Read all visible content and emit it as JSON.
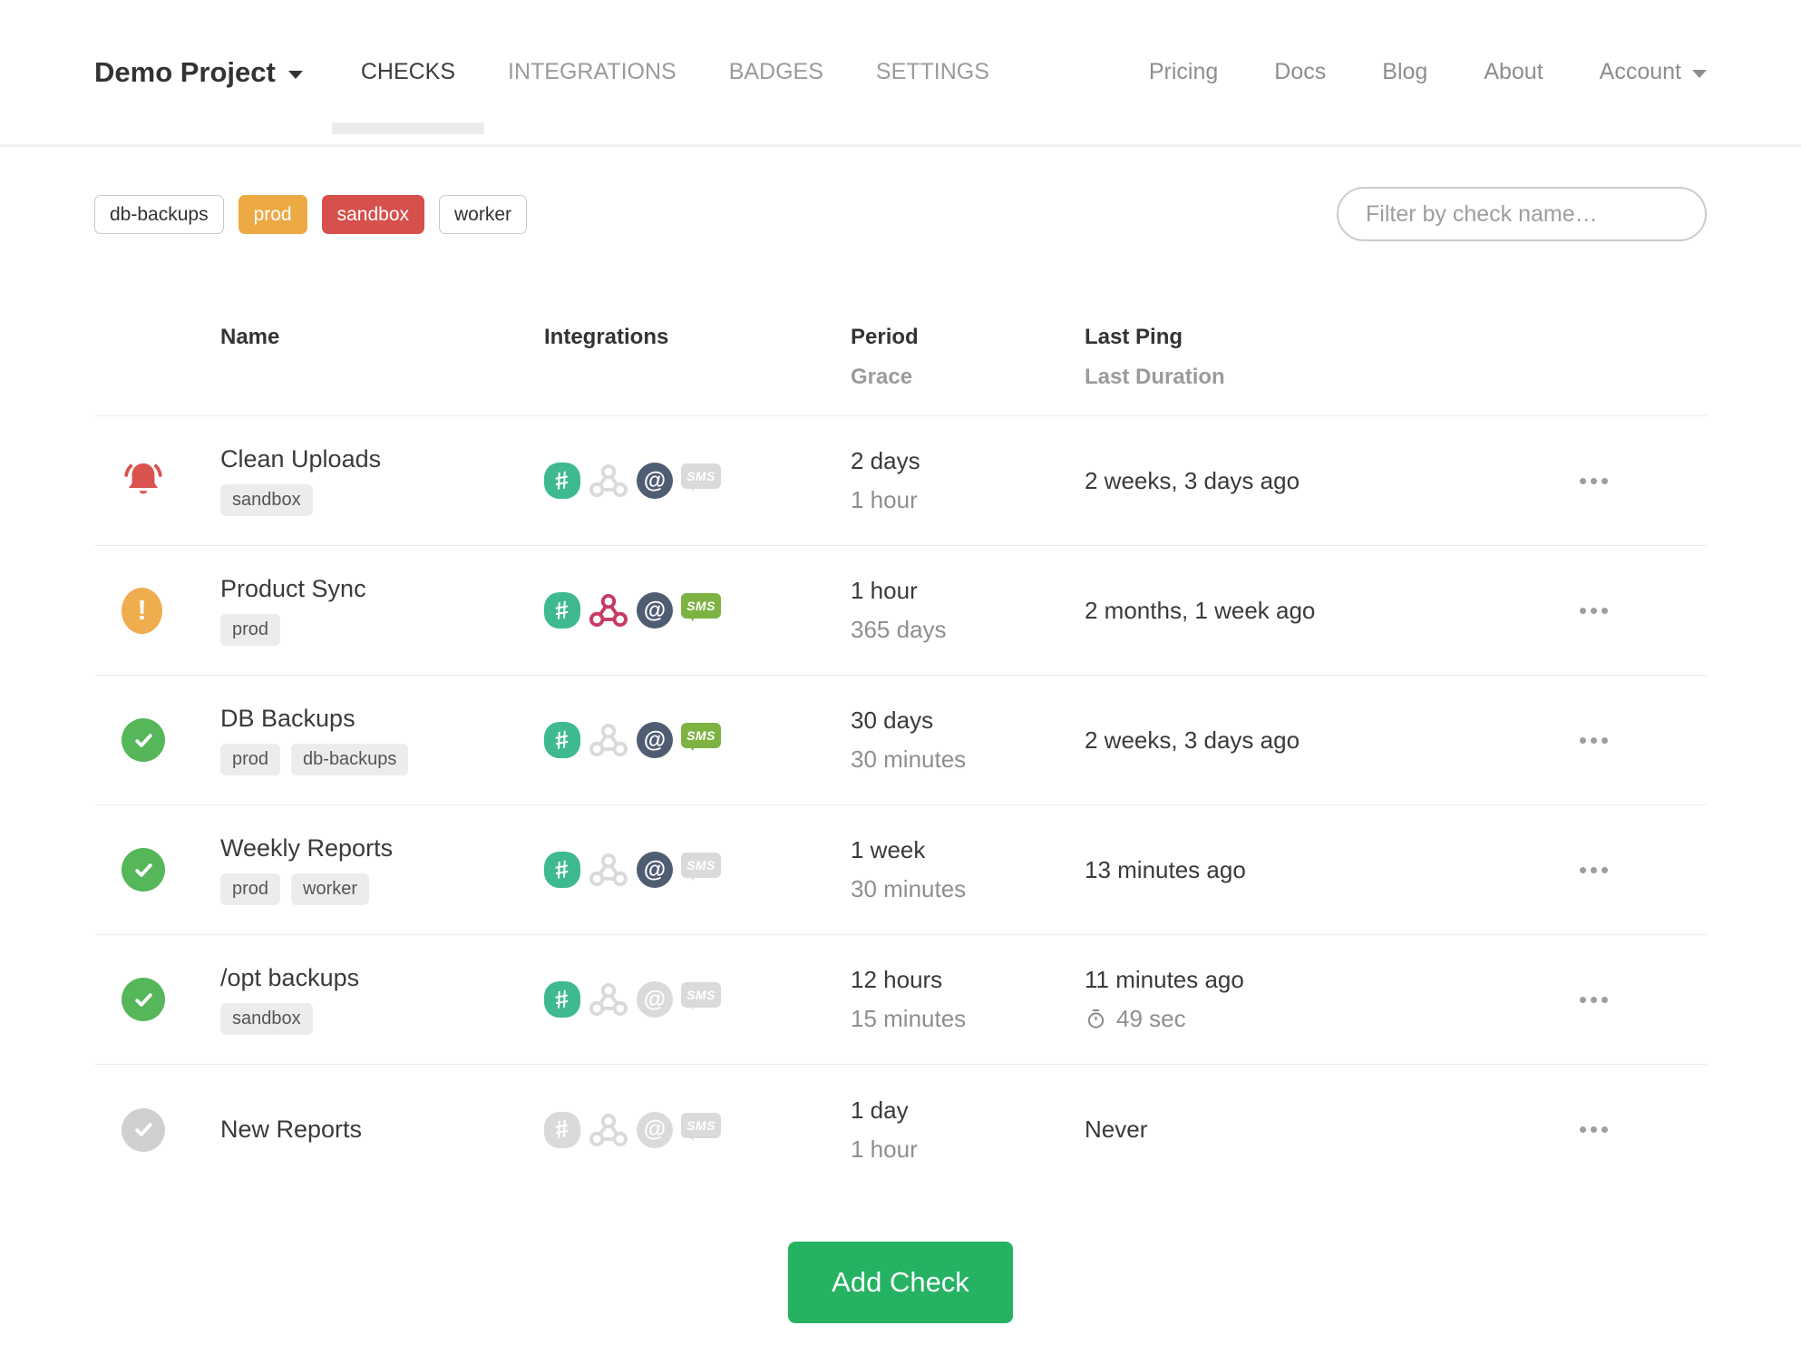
{
  "brand": {
    "project_name": "Demo Project"
  },
  "nav": {
    "tabs": [
      {
        "label": "CHECKS",
        "active": true
      },
      {
        "label": "INTEGRATIONS",
        "active": false
      },
      {
        "label": "BADGES",
        "active": false
      },
      {
        "label": "SETTINGS",
        "active": false
      }
    ],
    "links": [
      "Pricing",
      "Docs",
      "Blog",
      "About"
    ],
    "account_label": "Account"
  },
  "filters": {
    "tags": [
      {
        "label": "db-backups",
        "variant": "outline"
      },
      {
        "label": "prod",
        "variant": "orange"
      },
      {
        "label": "sandbox",
        "variant": "red"
      },
      {
        "label": "worker",
        "variant": "outline"
      }
    ],
    "search_placeholder": "Filter by check name…"
  },
  "table": {
    "headers": {
      "name": "Name",
      "integrations": "Integrations",
      "period": "Period",
      "grace": "Grace",
      "last_ping": "Last Ping",
      "last_duration": "Last Duration"
    },
    "rows": [
      {
        "name": "Clean Uploads",
        "status": "alert",
        "tags": [
          "sandbox"
        ],
        "integrations": {
          "slack": "on",
          "webhook": "off",
          "email": "on",
          "sms": "off"
        },
        "period": "2 days",
        "grace": "1 hour",
        "last_ping": "2 weeks, 3 days ago",
        "last_duration": ""
      },
      {
        "name": "Product Sync",
        "status": "warning",
        "tags": [
          "prod"
        ],
        "integrations": {
          "slack": "on",
          "webhook": "on",
          "email": "on",
          "sms": "on"
        },
        "period": "1 hour",
        "grace": "365 days",
        "last_ping": "2 months, 1 week ago",
        "last_duration": ""
      },
      {
        "name": "DB Backups",
        "status": "ok",
        "tags": [
          "prod",
          "db-backups"
        ],
        "integrations": {
          "slack": "on",
          "webhook": "off",
          "email": "on",
          "sms": "on"
        },
        "period": "30 days",
        "grace": "30 minutes",
        "last_ping": "2 weeks, 3 days ago",
        "last_duration": ""
      },
      {
        "name": "Weekly Reports",
        "status": "ok",
        "tags": [
          "prod",
          "worker"
        ],
        "integrations": {
          "slack": "on",
          "webhook": "off",
          "email": "on",
          "sms": "off"
        },
        "period": "1 week",
        "grace": "30 minutes",
        "last_ping": "13 minutes ago",
        "last_duration": ""
      },
      {
        "name": "/opt backups",
        "status": "ok",
        "tags": [
          "sandbox"
        ],
        "integrations": {
          "slack": "on",
          "webhook": "off",
          "email": "off",
          "sms": "off"
        },
        "period": "12 hours",
        "grace": "15 minutes",
        "last_ping": "11 minutes ago",
        "last_duration": "49 sec"
      },
      {
        "name": "New Reports",
        "status": "new",
        "tags": [],
        "integrations": {
          "slack": "off",
          "webhook": "off",
          "email": "off",
          "sms": "off"
        },
        "period": "1 day",
        "grace": "1 hour",
        "last_ping": "Never",
        "last_duration": ""
      }
    ]
  },
  "actions": {
    "add_check_label": "Add Check"
  },
  "colors": {
    "tag_orange": "#eca944",
    "tag_red": "#d6504c",
    "alert_red": "#d9534f",
    "status_warning_orange": "#f0ad4e",
    "status_ok_green": "#55b65a",
    "status_new_gray": "#d0d0d0",
    "slack_green": "#3eb991",
    "webhook_crimson": "#c73a63",
    "email_slate": "#4f5d73",
    "sms_green": "#7cb342",
    "button_green": "#25b263"
  }
}
